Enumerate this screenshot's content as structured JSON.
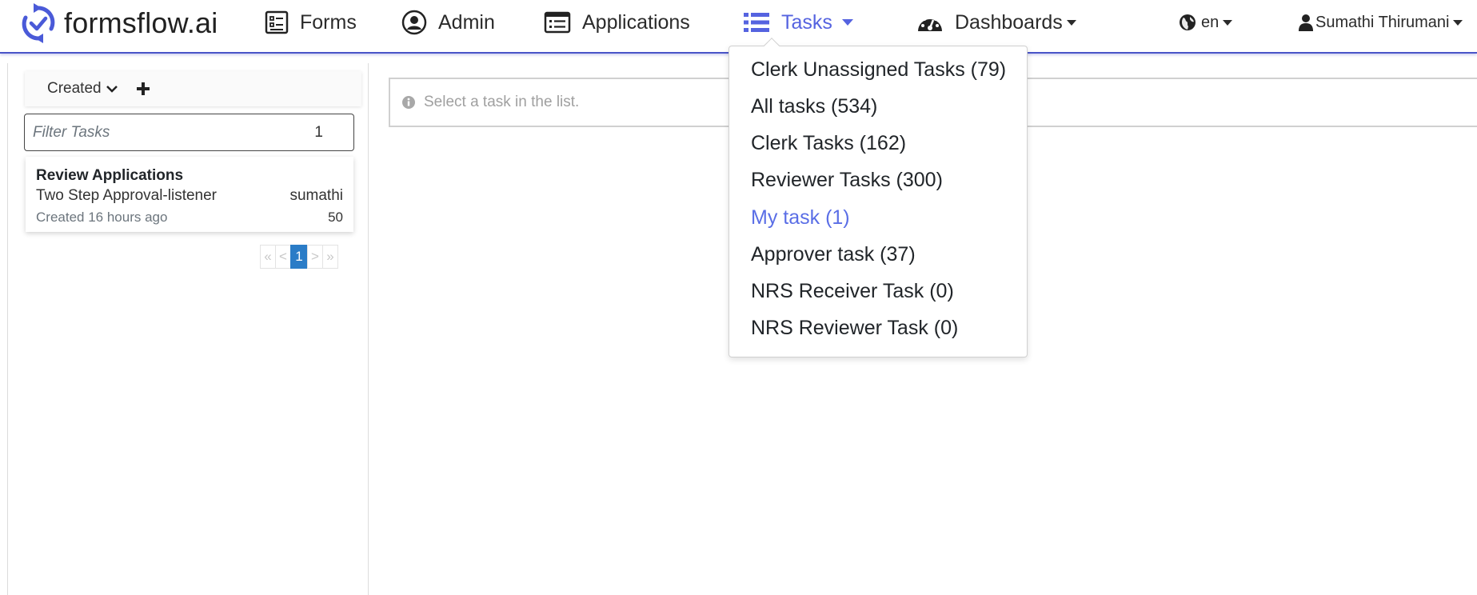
{
  "brand": {
    "name": "formsflow.ai"
  },
  "nav": {
    "forms": "Forms",
    "admin": "Admin",
    "applications": "Applications",
    "tasks": "Tasks",
    "dashboards": "Dashboards",
    "language": "en",
    "user": "Sumathi Thirumani"
  },
  "sidebar": {
    "sort_label": "Created",
    "filter_placeholder": "Filter Tasks",
    "filter_count": "1",
    "task": {
      "title": "Review Applications",
      "process": "Two Step Approval-listener",
      "assignee": "sumathi",
      "created": "Created 16 hours ago",
      "priority": "50"
    },
    "pager": {
      "first": "«",
      "prev": "<",
      "current": "1",
      "next": ">",
      "last": "»"
    }
  },
  "main": {
    "info_text": "Select a task in the list."
  },
  "tasks_menu": {
    "items": [
      {
        "label": "Clerk Unassigned Tasks (79)"
      },
      {
        "label": "All tasks (534)"
      },
      {
        "label": "Clerk Tasks (162)"
      },
      {
        "label": "Reviewer Tasks (300)"
      },
      {
        "label": "My task (1)",
        "selected": true
      },
      {
        "label": "Approver task (37)"
      },
      {
        "label": "NRS Receiver Task (0)"
      },
      {
        "label": "NRS Reviewer Task (0)"
      }
    ]
  },
  "colors": {
    "accent": "#5563e0",
    "nav_border": "#4a55c8",
    "pager_active": "#2a7cc7",
    "selected_item": "#5a6ee6"
  },
  "icons": [
    "refresh-logo-icon",
    "form-icon",
    "user-circle-icon",
    "list-card-icon",
    "tasks-list-icon",
    "dashboard-gauge-icon",
    "globe-icon",
    "user-icon",
    "chevron-down-icon",
    "plus-icon",
    "info-icon"
  ]
}
